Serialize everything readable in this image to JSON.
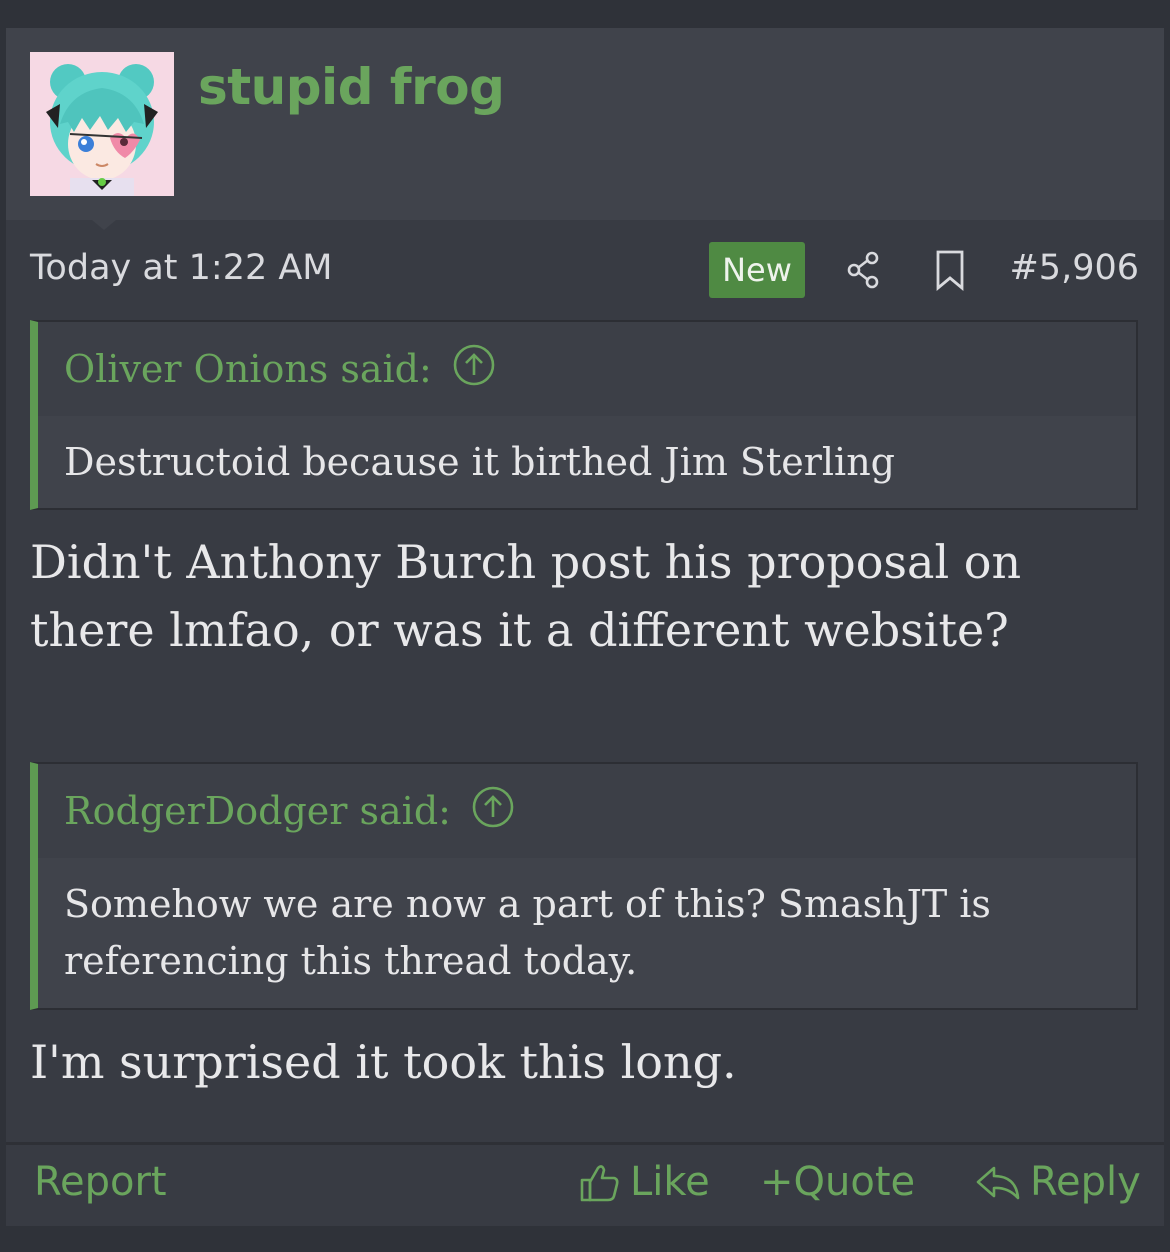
{
  "post": {
    "username": "stupid frog",
    "date": "Today at 1:22 AM",
    "badge": "New",
    "post_number": "#5,906",
    "icons": [
      "share-icon",
      "bookmark-icon",
      "arrow-up-circle-icon",
      "thumbs-up-icon",
      "reply-icon"
    ],
    "quotes": [
      {
        "author_line": "Oliver Onions said:",
        "text": "Destructoid because it birthed Jim Sterling"
      },
      {
        "author_line": "RodgerDodger said:",
        "text": "Somehow we are now a part of this? SmashJT is referencing this thread today."
      }
    ],
    "replies": [
      "Didn't Anthony Burch post his proposal on there lmfao, or was it a different website?",
      "I'm surprised it took this long."
    ]
  },
  "footer": {
    "report": "Report",
    "like": "Like",
    "quote": "+Quote",
    "reply": "Reply"
  },
  "colors": {
    "accent": "#6aa55d",
    "badge": "#4f8a43",
    "background": "#383b43"
  }
}
